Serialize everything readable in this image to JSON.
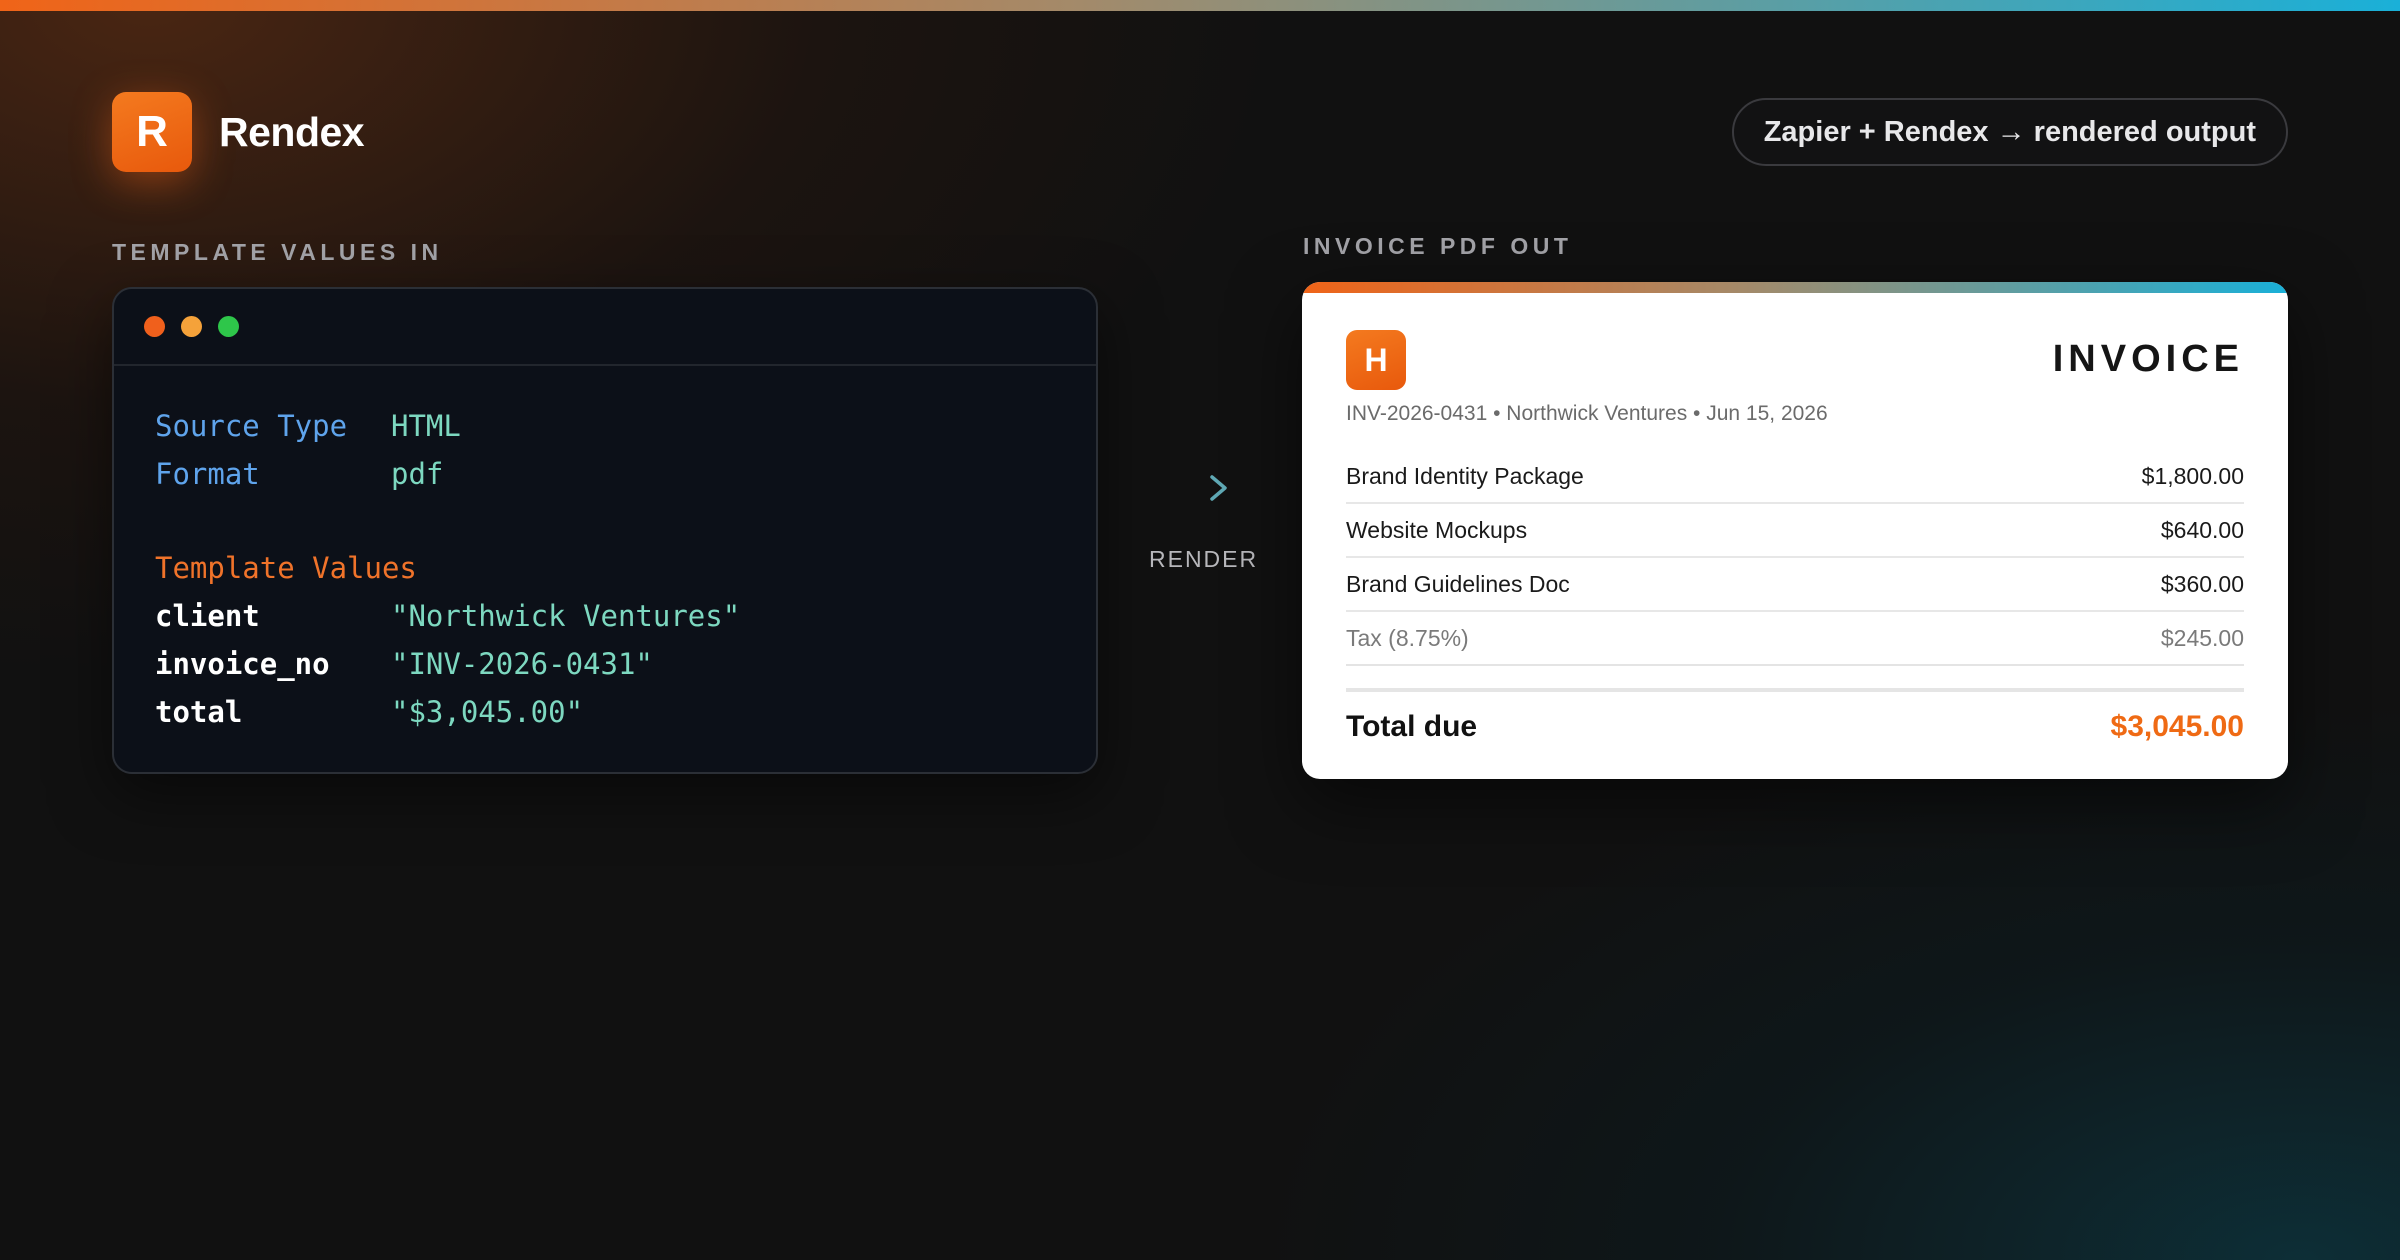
{
  "brand": {
    "logo_letter": "R",
    "name": "Rendex"
  },
  "header": {
    "pill_text": "Zapier + Rendex → rendered output"
  },
  "sections": {
    "input_label": "TEMPLATE VALUES IN",
    "output_label": "INVOICE PDF OUT"
  },
  "code": {
    "fields": [
      {
        "key": "Source Type",
        "value": "HTML"
      },
      {
        "key": "Format",
        "value": "pdf"
      }
    ],
    "template_header": "Template Values",
    "values": [
      {
        "key": "client",
        "value": "\"Northwick Ventures\""
      },
      {
        "key": "invoice_no",
        "value": "\"INV-2026-0431\""
      },
      {
        "key": "total",
        "value": "\"$3,045.00\""
      }
    ]
  },
  "render": {
    "label": "RENDER"
  },
  "invoice": {
    "logo_letter": "H",
    "title": "INVOICE",
    "meta": "INV-2026-0431 • Northwick Ventures • Jun 15, 2026",
    "items": [
      {
        "label": "Brand Identity Package",
        "amount": "$1,800.00"
      },
      {
        "label": "Website Mockups",
        "amount": "$640.00"
      },
      {
        "label": "Brand Guidelines Doc",
        "amount": "$360.00"
      }
    ],
    "tax": {
      "label": "Tax (8.75%)",
      "amount": "$245.00"
    },
    "total": {
      "label": "Total due",
      "amount": "$3,045.00"
    }
  },
  "colors": {
    "accent_orange": "#f06418",
    "accent_teal": "#1ab0d8",
    "code_key_blue": "#5fa4ec",
    "code_value_teal": "#7dd8c0"
  },
  "icons": {
    "render_arrow": "arrow-right-icon"
  }
}
